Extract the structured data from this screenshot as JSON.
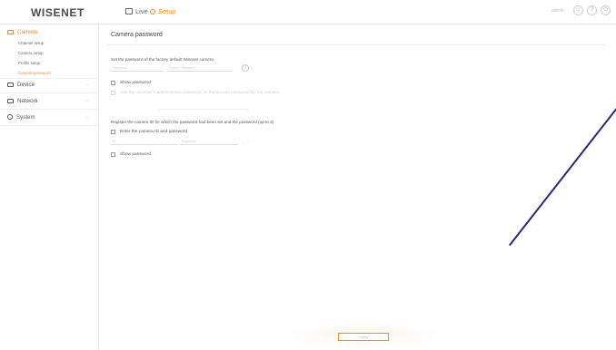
{
  "header": {
    "logo": "WISENET",
    "nav_live": "Live",
    "nav_setup": "Setup",
    "user_label": "admin",
    "icon_user": "user-icon",
    "icon_help": "help-icon",
    "icon_logout": "logout-icon"
  },
  "sidebar": {
    "camera": {
      "label": "Camera",
      "items": [
        "Channel setup",
        "Camera setup",
        "Profile setup",
        "Camera password"
      ]
    },
    "device": {
      "label": "Device"
    },
    "network": {
      "label": "Network"
    },
    "system": {
      "label": "System"
    }
  },
  "main": {
    "title": "Camera password",
    "section1": {
      "label": "Set the password of the factory default Wisenet camera",
      "password_placeholder": "Password",
      "confirm_placeholder": "Confirm Password",
      "show_password": "Show password",
      "use_recorder_pw": "Use the recorder's administrator password as the access password for the camera"
    },
    "section2": {
      "label": "Register the camera ID for which the password had been set and the password (up to 3)",
      "enter_id_pw": "Enter the camera ID and password",
      "id_placeholder": "ID",
      "password_placeholder": "Password",
      "show_password": "Show password"
    },
    "apply_label": "Apply"
  },
  "colors": {
    "accent": "#f08a32",
    "text": "#555555",
    "divider": "#e6e6e6"
  }
}
